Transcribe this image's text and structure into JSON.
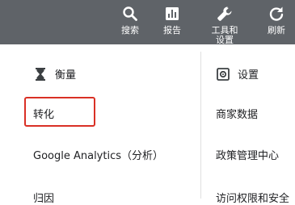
{
  "toolbar": {
    "items": [
      {
        "label": "搜索",
        "icon": "search-icon"
      },
      {
        "label": "报告",
        "icon": "report-icon"
      },
      {
        "label": "工具和设置",
        "icon": "wrench-icon"
      },
      {
        "label": "刷新",
        "icon": "refresh-icon"
      }
    ]
  },
  "menu": {
    "left_section": {
      "title": "衡量",
      "icon": "hourglass-icon",
      "items": [
        "转化",
        "Google Analytics（分析）",
        "归因"
      ]
    },
    "right_section": {
      "title": "设置",
      "icon": "gear-icon",
      "items": [
        "商家数据",
        "政策管理中心",
        "访问权限和安全"
      ]
    }
  },
  "colors": {
    "topbar": "#5f6368",
    "highlight_border": "#d93025"
  }
}
